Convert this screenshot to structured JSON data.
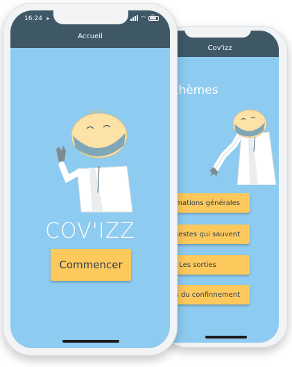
{
  "front": {
    "status": {
      "time": "16:24"
    },
    "header": {
      "title": "Accueil"
    },
    "brand": "COV'IZZ",
    "start_button": "Commencer"
  },
  "back": {
    "header": {
      "title": "Cov'izz"
    },
    "section_title": "es thèmes",
    "themes": [
      {
        "label": "ormations générales"
      },
      {
        "label": "s gestes qui sauvent"
      },
      {
        "label": "Les sorties"
      },
      {
        "label": "egles du confinnement"
      }
    ]
  },
  "colors": {
    "screen_bg": "#8ecbf0",
    "header_bg": "#3f5866",
    "button_bg": "#fdc95c",
    "button_text": "#2c3e50"
  }
}
